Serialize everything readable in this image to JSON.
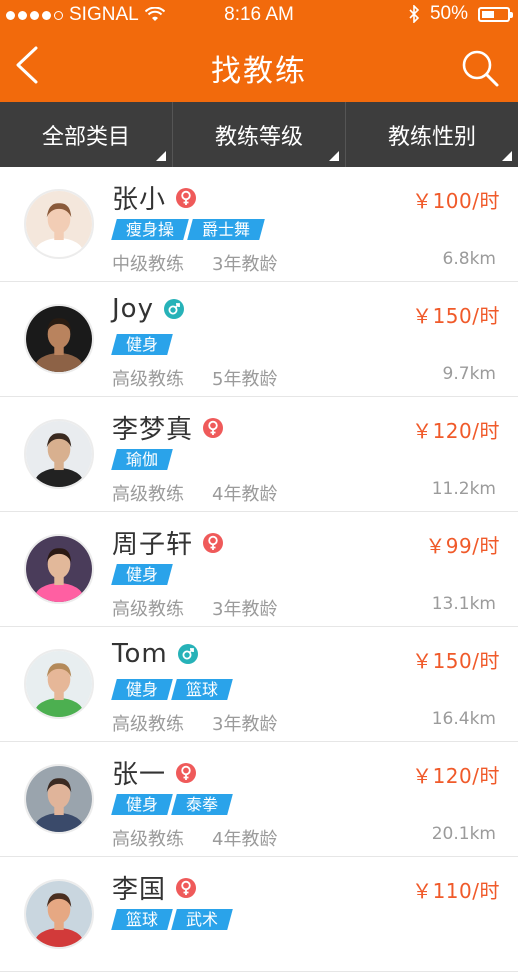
{
  "status_bar": {
    "carrier": "SIGNAL",
    "time": "8:16 AM",
    "battery_text": "50%",
    "battery_level": 0.5,
    "icons": [
      "signal-dots-icon",
      "wifi-icon",
      "bluetooth-icon",
      "battery-icon"
    ]
  },
  "nav": {
    "title": "找教练",
    "back_icon": "chevron-left-icon",
    "search_icon": "search-icon"
  },
  "filters": [
    {
      "label": "全部类目"
    },
    {
      "label": "教练等级"
    },
    {
      "label": "教练性别"
    }
  ],
  "colors": {
    "brand": "#f26a0c",
    "filter_bar": "#3d3d3d",
    "price": "#f05a2a",
    "tag": "#2aa3ea",
    "female": "#ef5a5a",
    "male": "#27b2b8"
  },
  "coaches": [
    {
      "name": "张小",
      "gender": "female",
      "price": "￥100/时",
      "tags": [
        "瘦身操",
        "爵士舞"
      ],
      "level": "中级教练",
      "years": "3年教龄",
      "distance": "6.8km"
    },
    {
      "name": "Joy",
      "gender": "male",
      "price": "￥150/时",
      "tags": [
        "健身"
      ],
      "level": "高级教练",
      "years": "5年教龄",
      "distance": "9.7km"
    },
    {
      "name": "李梦真",
      "gender": "female",
      "price": "￥120/时",
      "tags": [
        "瑜伽"
      ],
      "level": "高级教练",
      "years": "4年教龄",
      "distance": "11.2km"
    },
    {
      "name": "周子轩",
      "gender": "female",
      "price": "￥99/时",
      "tags": [
        "健身"
      ],
      "level": "高级教练",
      "years": "3年教龄",
      "distance": "13.1km"
    },
    {
      "name": "Tom",
      "gender": "male",
      "price": "￥150/时",
      "tags": [
        "健身",
        "篮球"
      ],
      "level": "高级教练",
      "years": "3年教龄",
      "distance": "16.4km"
    },
    {
      "name": "张一",
      "gender": "female",
      "price": "￥120/时",
      "tags": [
        "健身",
        "泰拳"
      ],
      "level": "高级教练",
      "years": "4年教龄",
      "distance": "20.1km"
    },
    {
      "name": "李国",
      "gender": "female",
      "price": "￥110/时",
      "tags": [
        "篮球",
        "武术"
      ],
      "level": "",
      "years": "",
      "distance": ""
    }
  ]
}
